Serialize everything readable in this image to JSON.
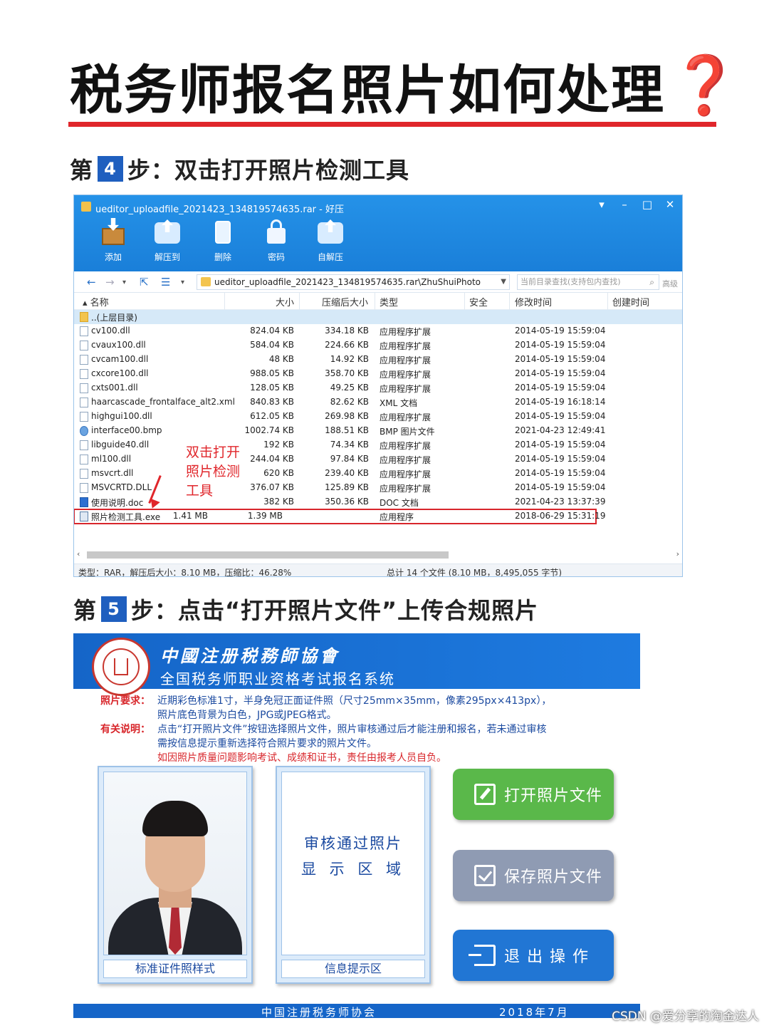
{
  "title": {
    "text": "税务师报名照片如何处理",
    "mark": "❓"
  },
  "step4": {
    "prefix": "第",
    "number": "4",
    "suffix": "步：双击打开照片检测工具"
  },
  "archive": {
    "window_title": "ueditor_uploadfile_2021423_134819574635.rar - 好压",
    "toolbar": [
      "添加",
      "解压到",
      "删除",
      "密码",
      "自解压"
    ],
    "address": "ueditor_uploadfile_2021423_134819574635.rar\\ZhuShuiPhoto",
    "search_placeholder": "当前目录查找(支持包内查找)",
    "advanced": "高级",
    "columns": {
      "name": "名称",
      "size": "大小",
      "csize": "压缩后大小",
      "type": "类型",
      "safe": "安全",
      "mtime": "修改时间",
      "ctime": "创建时间"
    },
    "parent": "..(上层目录)",
    "files": [
      {
        "name": "cv100.dll",
        "size": "824.04 KB",
        "csize": "334.18 KB",
        "type": "应用程序扩展",
        "mtime": "2014-05-19 15:59:04",
        "icon": "dll"
      },
      {
        "name": "cvaux100.dll",
        "size": "584.04 KB",
        "csize": "224.66 KB",
        "type": "应用程序扩展",
        "mtime": "2014-05-19 15:59:04",
        "icon": "dll"
      },
      {
        "name": "cvcam100.dll",
        "size": "48 KB",
        "csize": "14.92 KB",
        "type": "应用程序扩展",
        "mtime": "2014-05-19 15:59:04",
        "icon": "dll"
      },
      {
        "name": "cxcore100.dll",
        "size": "988.05 KB",
        "csize": "358.70 KB",
        "type": "应用程序扩展",
        "mtime": "2014-05-19 15:59:04",
        "icon": "dll"
      },
      {
        "name": "cxts001.dll",
        "size": "128.05 KB",
        "csize": "49.25 KB",
        "type": "应用程序扩展",
        "mtime": "2014-05-19 15:59:04",
        "icon": "dll"
      },
      {
        "name": "haarcascade_frontalface_alt2.xml",
        "size": "840.83 KB",
        "csize": "82.62 KB",
        "type": "XML 文档",
        "mtime": "2014-05-19 16:18:14",
        "icon": "xml"
      },
      {
        "name": "highgui100.dll",
        "size": "612.05 KB",
        "csize": "269.98 KB",
        "type": "应用程序扩展",
        "mtime": "2014-05-19 15:59:04",
        "icon": "dll"
      },
      {
        "name": "interface00.bmp",
        "size": "1002.74 KB",
        "csize": "188.51 KB",
        "type": "BMP 图片文件",
        "mtime": "2021-04-23 12:49:41",
        "icon": "bmp"
      },
      {
        "name": "libguide40.dll",
        "size": "192 KB",
        "csize": "74.34 KB",
        "type": "应用程序扩展",
        "mtime": "2014-05-19 15:59:04",
        "icon": "dll"
      },
      {
        "name": "ml100.dll",
        "size": "244.04 KB",
        "csize": "97.84 KB",
        "type": "应用程序扩展",
        "mtime": "2014-05-19 15:59:04",
        "icon": "dll"
      },
      {
        "name": "msvcrt.dll",
        "size": "620 KB",
        "csize": "239.40 KB",
        "type": "应用程序扩展",
        "mtime": "2014-05-19 15:59:04",
        "icon": "dll"
      },
      {
        "name": "MSVCRTD.DLL",
        "size": "376.07 KB",
        "csize": "125.89 KB",
        "type": "应用程序扩展",
        "mtime": "2014-05-19 15:59:04",
        "icon": "dll"
      },
      {
        "name": "使用说明.doc",
        "size": "382 KB",
        "csize": "350.36 KB",
        "type": "DOC 文档",
        "mtime": "2021-04-23 13:37:39",
        "icon": "doc"
      },
      {
        "name": "照片检测工具.exe",
        "size": "1.41 MB",
        "csize": "1.39 MB",
        "type": "应用程序",
        "mtime": "2018-06-29 15:31:19",
        "icon": "exe"
      }
    ],
    "annotation": [
      "双击打开",
      "照片检测",
      "工具"
    ],
    "status_left": "类型：RAR，解压后大小：8.10 MB，压缩比：46.28%",
    "status_right": "总计 14 个文件 (8.10 MB，8,495,055 字节)"
  },
  "step5": {
    "prefix": "第",
    "number": "5",
    "suffix": "步：点击“打开照片文件”上传合规照片"
  },
  "system": {
    "org": "中國注册税務師協會",
    "name": "全国税务师职业资格考试报名系统",
    "req_label": "照片要求：",
    "req_line1": "近期彩色标准1寸，半身免冠正面证件照（尺寸25mm×35mm，像素295px×413px），",
    "req_line2": "照片底色背景为白色，JPG或JPEG格式。",
    "note_label": "有关说明：",
    "note_line1": "点击“打开照片文件”按钮选择照片文件，照片审核通过后才能注册和报名，若未通过审核",
    "note_line2": "需按信息提示重新选择符合照片要求的照片文件。",
    "note_line3": "如因照片质量问题影响考试、成绩和证书，责任由报考人员自负。",
    "sample_caption": "标准证件照样式",
    "review_line1": "审核通过照片",
    "review_line2": "显 示 区 域",
    "info_caption": "信息提示区",
    "btn_open": "打开照片文件",
    "btn_save": "保存照片文件",
    "btn_exit": "退出操作",
    "footer_left": "中国注册税务师协会",
    "footer_right": "2018年7月"
  },
  "watermark": "CSDN @爱分享的淘金达人",
  "colors": {
    "accent_red": "#e0262b",
    "brand_blue": "#1565c8",
    "button_green": "#5ab84a",
    "button_gray": "#8f9bb3",
    "button_blue": "#2176d4"
  }
}
